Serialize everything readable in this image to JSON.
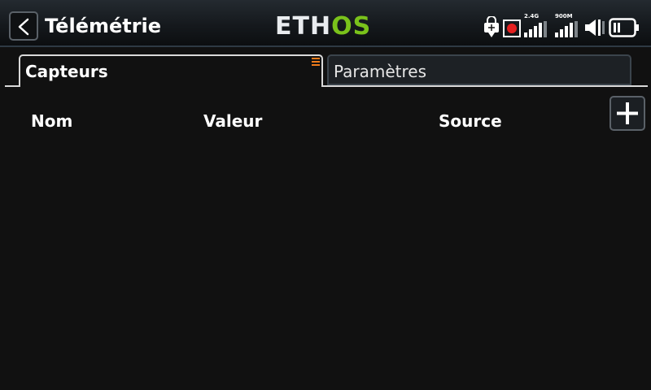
{
  "header": {
    "title": "Télémétrie",
    "logo": {
      "part1": "ETH",
      "part2": "OS"
    },
    "status": {
      "usb_icon": "usb-lock-icon",
      "record_icon": "record-icon",
      "signal_24": {
        "label": "2.4G",
        "bars": 4
      },
      "signal_900": {
        "label": "900M",
        "bars": 4
      },
      "volume_icon": "speaker-icon",
      "battery_icon": "battery-icon"
    }
  },
  "tabs": [
    {
      "label": "Capteurs",
      "active": true
    },
    {
      "label": "Paramètres",
      "active": false
    }
  ],
  "table": {
    "columns": [
      "Nom",
      "Valeur",
      "Source"
    ]
  },
  "colors": {
    "accent_green": "#7ac21b",
    "menu_orange": "#f07c1b",
    "record_red": "#e52020"
  }
}
